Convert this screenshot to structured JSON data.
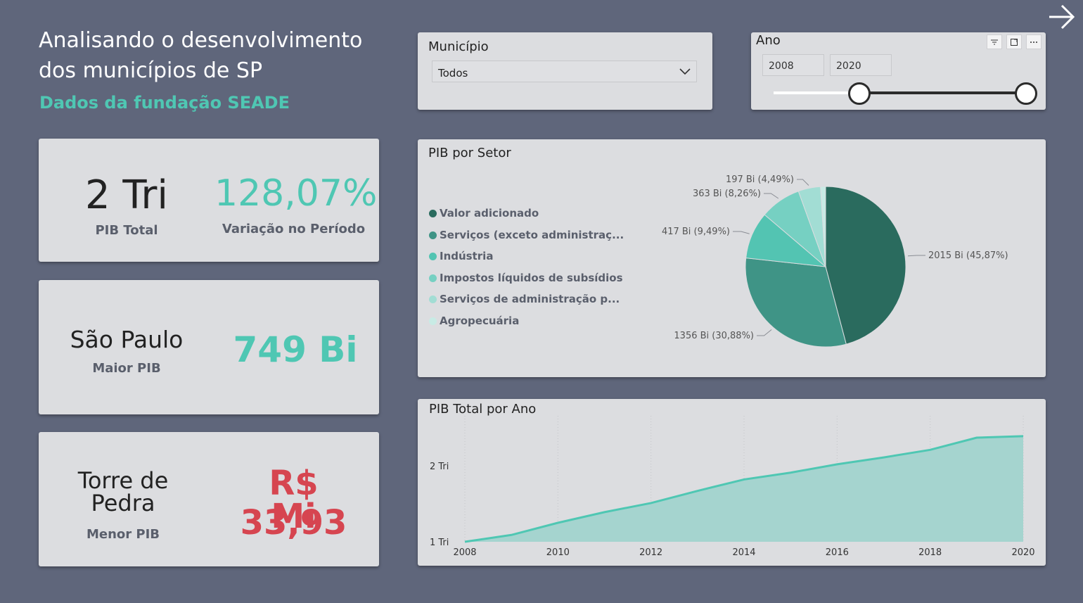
{
  "header": {
    "title": "Analisando o desenvolvimento dos municípios de SP",
    "subtitle": "Dados da fundação SEADE"
  },
  "kpis": {
    "pib_total": {
      "value": "2 Tri",
      "label": "PIB Total"
    },
    "variacao": {
      "value": "128,07%",
      "label": "Variação no Período"
    },
    "maior": {
      "name": "São Paulo",
      "label": "Maior PIB",
      "value": "749 Bi"
    },
    "menor": {
      "name_line1": "Torre de",
      "name_line2": "Pedra",
      "label": "Menor PIB",
      "value_line1": "R$ 33,93",
      "value_line2": "Mi"
    }
  },
  "slicers": {
    "municipio": {
      "title": "Município",
      "selected": "Todos"
    },
    "ano": {
      "title": "Ano",
      "from": "2008",
      "to": "2020",
      "range": [
        2008,
        2020
      ],
      "min": 2002,
      "max": 2020
    }
  },
  "colors": {
    "background": "#5f667b",
    "accent": "#4fc7b3",
    "negative": "#d64550",
    "card": "#dcdde0"
  },
  "chart_data": [
    {
      "type": "pie",
      "title": "PIB por Setor",
      "legend_position": "left",
      "slices": [
        {
          "name": "Valor adicionado",
          "legend_label": "Valor adicionado",
          "value": 2015,
          "label": "2015 Bi (45,87%)",
          "color": "#2a6b5e"
        },
        {
          "name": "Serviços (exceto administração pública)",
          "legend_label": "Serviços (exceto administraç...",
          "value": 1356,
          "label": "1356 Bi (30,88%)",
          "color": "#3f9486"
        },
        {
          "name": "Indústria",
          "legend_label": "Indústria",
          "value": 417,
          "label": "417 Bi (9,49%)",
          "color": "#53c4b2"
        },
        {
          "name": "Impostos líquidos de subsídios",
          "legend_label": "Impostos líquidos de subsídios",
          "value": 363,
          "label": "363 Bi (8,26%)",
          "color": "#76d0c2"
        },
        {
          "name": "Serviços de administração pública",
          "legend_label": "Serviços de administração p...",
          "value": 197,
          "label": "197 Bi (4,49%)",
          "color": "#a2ddd4"
        },
        {
          "name": "Agropecuária",
          "legend_label": "Agropecuária",
          "value": 45,
          "label": "",
          "color": "#c8ebe5"
        }
      ]
    },
    {
      "type": "area",
      "title": "PIB Total por Ano",
      "x": [
        2008,
        2009,
        2010,
        2011,
        2012,
        2013,
        2014,
        2015,
        2016,
        2017,
        2018,
        2019,
        2020
      ],
      "y": [
        1.0,
        1.09,
        1.25,
        1.39,
        1.51,
        1.67,
        1.82,
        1.91,
        2.02,
        2.11,
        2.21,
        2.37,
        2.39
      ],
      "x_ticks": [
        "2008",
        "2010",
        "2012",
        "2014",
        "2016",
        "2018",
        "2020"
      ],
      "y_ticks": [
        "1 Tri",
        "2 Tri"
      ],
      "y_tick_values": [
        1.0,
        2.0
      ],
      "ylim": [
        1.0,
        2.75
      ],
      "units": "Tri",
      "line_color": "#4fc7b3",
      "fill_color": "#a5d4cf",
      "grid": "vertical dotted"
    }
  ]
}
